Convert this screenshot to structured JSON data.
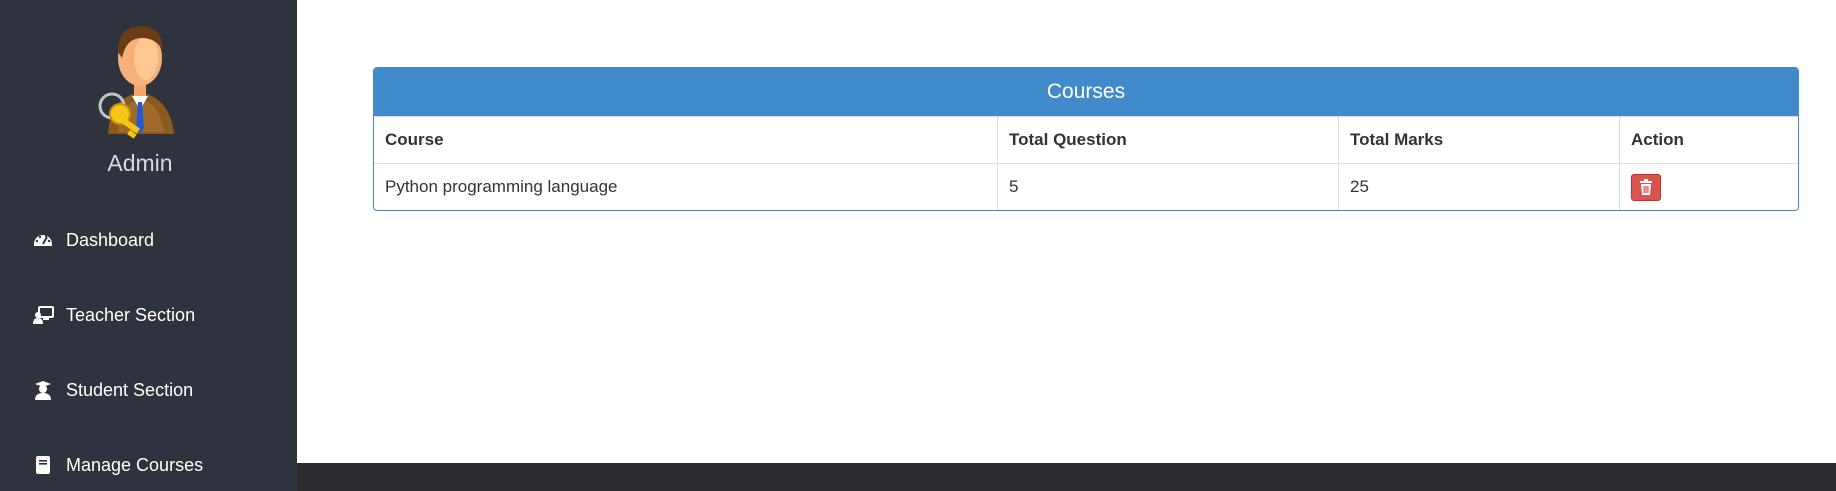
{
  "sidebar": {
    "user": {
      "name": "Admin",
      "avatar_icon": "admin-avatar-with-keys"
    },
    "items": [
      {
        "label": "Dashboard",
        "icon": "dashboard-icon"
      },
      {
        "label": "Teacher Section",
        "icon": "teacher-icon"
      },
      {
        "label": "Student Section",
        "icon": "student-icon"
      },
      {
        "label": "Manage Courses",
        "icon": "book-icon"
      }
    ]
  },
  "courses_panel": {
    "title": "Courses",
    "columns": [
      "Course",
      "Total Question",
      "Total Marks",
      "Action"
    ],
    "rows": [
      {
        "course": "Python programming language",
        "total_question": "5",
        "total_marks": "25",
        "action_icon": "trash-icon"
      }
    ]
  },
  "colors": {
    "sidebar_bg": "#2f333e",
    "panel_primary": "#428bca",
    "danger": "#d9534f",
    "footer_bg": "#2a2c31"
  }
}
